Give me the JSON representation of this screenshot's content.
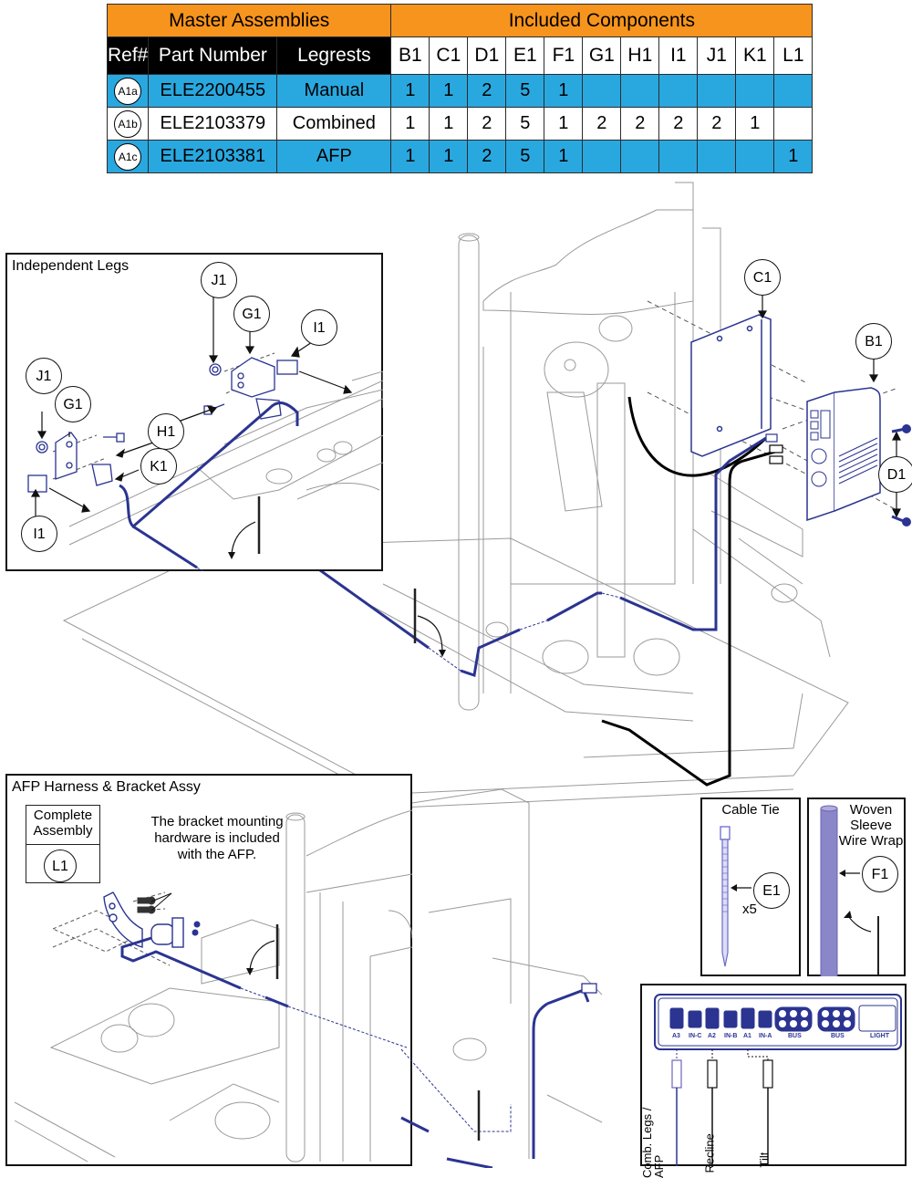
{
  "table": {
    "group_headers": {
      "master": "Master Assemblies",
      "included": "Included Components"
    },
    "columns": {
      "ref": "Ref#",
      "part_number": "Part Number",
      "legrests": "Legrests"
    },
    "component_columns": [
      "B1",
      "C1",
      "D1",
      "E1",
      "F1",
      "G1",
      "H1",
      "I1",
      "J1",
      "K1",
      "L1"
    ],
    "rows": [
      {
        "ref": "A1a",
        "part_number": "ELE2200455",
        "legrests": "Manual",
        "quantities": [
          "1",
          "1",
          "2",
          "5",
          "1",
          "",
          "",
          "",
          "",
          "",
          ""
        ]
      },
      {
        "ref": "A1b",
        "part_number": "ELE2103379",
        "legrests": "Combined",
        "quantities": [
          "1",
          "1",
          "2",
          "5",
          "1",
          "2",
          "2",
          "2",
          "2",
          "1",
          ""
        ]
      },
      {
        "ref": "A1c",
        "part_number": "ELE2103381",
        "legrests": "AFP",
        "quantities": [
          "1",
          "1",
          "2",
          "5",
          "1",
          "",
          "",
          "",
          "",
          "",
          "1"
        ]
      }
    ],
    "colors": {
      "group_header": "#f7941d",
      "highlight_row": "#29a8e0",
      "dark_header": "#000000"
    }
  },
  "main_callouts": {
    "c1": "C1",
    "b1": "B1",
    "d1": "D1"
  },
  "independent_legs": {
    "title": "Independent Legs",
    "callouts": {
      "j1_top": "J1",
      "g1_top": "G1",
      "i1_top": "I1",
      "j1_left": "J1",
      "g1_left": "G1",
      "h1": "H1",
      "k1": "K1",
      "i1_bottom": "I1"
    }
  },
  "afp_panel": {
    "title": "AFP Harness & Bracket Assy",
    "complete_assembly_label": "Complete Assembly",
    "complete_assembly_ref": "L1",
    "note": "The bracket mounting hardware is included with the AFP."
  },
  "cable_tie_panel": {
    "title": "Cable Tie",
    "callout": "E1",
    "quantity": "x5"
  },
  "sleeve_panel": {
    "title": "Woven Sleeve Wire Wrap",
    "callout": "F1"
  },
  "controller_panel": {
    "ports": [
      "A3",
      "IN-C",
      "A2",
      "IN-B",
      "A1",
      "IN-A",
      "BUS",
      "BUS",
      "LIGHT"
    ],
    "cables": [
      "Comb. Legs / AFP",
      "Recline",
      "Tilt"
    ]
  },
  "colors": {
    "harness_blue": "#2b3491",
    "cable_black": "#000000",
    "line_gray": "#9a9a9a",
    "sleeve_purple": "#8b86c9"
  }
}
